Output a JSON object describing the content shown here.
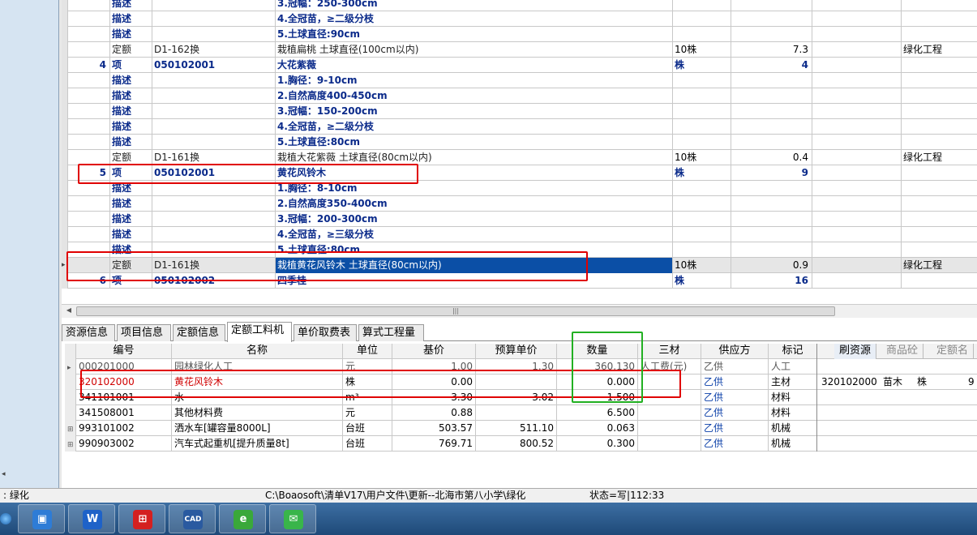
{
  "upper_grid": {
    "rows": [
      {
        "seq": "",
        "type": "描述",
        "code": "",
        "name": "3.冠幅：250-300cm",
        "unit": "",
        "qty": "",
        "cat": "",
        "kind": "desc"
      },
      {
        "seq": "",
        "type": "描述",
        "code": "",
        "name": "4.全冠苗，≥二级分枝",
        "unit": "",
        "qty": "",
        "cat": "",
        "kind": "desc"
      },
      {
        "seq": "",
        "type": "描述",
        "code": "",
        "name": "5.土球直径:90cm",
        "unit": "",
        "qty": "",
        "cat": "",
        "kind": "desc"
      },
      {
        "seq": "",
        "type": "定额",
        "code": "D1-162换",
        "name": "栽植扁桃 土球直径(100cm以内)",
        "unit": "10株",
        "qty": "7.3",
        "cat": "绿化工程",
        "kind": "quota"
      },
      {
        "seq": "4",
        "type": "项",
        "code": "050102001",
        "name": "大花紫薇",
        "unit": "株",
        "qty": "4",
        "cat": "",
        "kind": "bold"
      },
      {
        "seq": "",
        "type": "描述",
        "code": "",
        "name": "1.胸径：9-10cm",
        "unit": "",
        "qty": "",
        "cat": "",
        "kind": "desc"
      },
      {
        "seq": "",
        "type": "描述",
        "code": "",
        "name": "2.自然高度400-450cm",
        "unit": "",
        "qty": "",
        "cat": "",
        "kind": "desc"
      },
      {
        "seq": "",
        "type": "描述",
        "code": "",
        "name": "3.冠幅：150-200cm",
        "unit": "",
        "qty": "",
        "cat": "",
        "kind": "desc"
      },
      {
        "seq": "",
        "type": "描述",
        "code": "",
        "name": "4.全冠苗，≥二级分枝",
        "unit": "",
        "qty": "",
        "cat": "",
        "kind": "desc"
      },
      {
        "seq": "",
        "type": "描述",
        "code": "",
        "name": "5.土球直径:80cm",
        "unit": "",
        "qty": "",
        "cat": "",
        "kind": "desc"
      },
      {
        "seq": "",
        "type": "定额",
        "code": "D1-161换",
        "name": "栽植大花紫薇 土球直径(80cm以内)",
        "unit": "10株",
        "qty": "0.4",
        "cat": "绿化工程",
        "kind": "quota"
      },
      {
        "seq": "5",
        "type": "项",
        "code": "050102001",
        "name": "黄花风铃木",
        "unit": "株",
        "qty": "9",
        "cat": "",
        "kind": "bold"
      },
      {
        "seq": "",
        "type": "描述",
        "code": "",
        "name": "1.胸径：8-10cm",
        "unit": "",
        "qty": "",
        "cat": "",
        "kind": "desc"
      },
      {
        "seq": "",
        "type": "描述",
        "code": "",
        "name": "2.自然高度350-400cm",
        "unit": "",
        "qty": "",
        "cat": "",
        "kind": "desc"
      },
      {
        "seq": "",
        "type": "描述",
        "code": "",
        "name": "3.冠幅：200-300cm",
        "unit": "",
        "qty": "",
        "cat": "",
        "kind": "desc"
      },
      {
        "seq": "",
        "type": "描述",
        "code": "",
        "name": "4.全冠苗，≥三级分枝",
        "unit": "",
        "qty": "",
        "cat": "",
        "kind": "desc"
      },
      {
        "seq": "",
        "type": "描述",
        "code": "",
        "name": "5.土球直径:80cm",
        "unit": "",
        "qty": "",
        "cat": "",
        "kind": "desc"
      },
      {
        "seq": "",
        "type": "定额",
        "code": "D1-161换",
        "name": "栽植黄花风铃木 土球直径(80cm以内)",
        "unit": "10株",
        "qty": "0.9",
        "cat": "绿化工程",
        "kind": "quota sel"
      },
      {
        "seq": "6",
        "type": "项",
        "code": "050102002",
        "name": "四季桂",
        "unit": "株",
        "qty": "16",
        "cat": "",
        "kind": "bold"
      }
    ]
  },
  "tabs": [
    "资源信息",
    "项目信息",
    "定额信息",
    "定额工料机",
    "单价取费表",
    "算式工程量"
  ],
  "lower_grid": {
    "headers": [
      "编号",
      "名称",
      "单位",
      "基价",
      "预算单价",
      "数量",
      "三材",
      "供应方",
      "标记"
    ],
    "rows": [
      {
        "code": "000201000",
        "name": "园林绿化人工",
        "unit": "元",
        "base": "1.00",
        "price": "1.30",
        "qty": "360.130",
        "three": "人工费(元)",
        "supplier": "乙供",
        "mark": "人工",
        "tree": "",
        "style": "struck"
      },
      {
        "code": "320102000",
        "name": "黄花风铃木",
        "unit": "株",
        "base": "0.00",
        "price": "",
        "qty": "0.000",
        "three": "",
        "supplier": "乙供",
        "mark": "主材",
        "tree": "",
        "style": "red"
      },
      {
        "code": "341101001",
        "name": "水",
        "unit": "m³",
        "base": "3.30",
        "price": "3.02",
        "qty": "1.500",
        "three": "",
        "supplier": "乙供",
        "mark": "材料",
        "tree": "",
        "style": ""
      },
      {
        "code": "341508001",
        "name": "其他材料费",
        "unit": "元",
        "base": "0.88",
        "price": "",
        "qty": "6.500",
        "three": "",
        "supplier": "乙供",
        "mark": "材料",
        "tree": "",
        "style": ""
      },
      {
        "code": "993101002",
        "name": "洒水车[罐容量8000L]",
        "unit": "台班",
        "base": "503.57",
        "price": "511.10",
        "qty": "0.063",
        "three": "",
        "supplier": "乙供",
        "mark": "机械",
        "tree": "⊞",
        "style": ""
      },
      {
        "code": "990903002",
        "name": "汽车式起重机[提升质量8t]",
        "unit": "台班",
        "base": "769.71",
        "price": "800.52",
        "qty": "0.300",
        "three": "",
        "supplier": "乙供",
        "mark": "机械",
        "tree": "⊞",
        "style": ""
      }
    ]
  },
  "side_panel": {
    "tabs": [
      "刷资源",
      "商品砼",
      "定额名"
    ],
    "row": {
      "code": "320102000",
      "name": "苗木",
      "unit": "株",
      "value": "9"
    }
  },
  "statusbar": {
    "left": ": 绿化",
    "path": "C:\\Boaosoft\\清单V17\\用户文件\\更新--北海市第八小学\\绿化",
    "state": "状态=写|112:33"
  },
  "taskbar": {
    "apps": [
      {
        "icon": "box-app-icon",
        "glyph": "▣",
        "color": "#2e7cd6"
      },
      {
        "icon": "wps-icon",
        "glyph": "W",
        "color": "#1e62c8"
      },
      {
        "icon": "calculator-app-icon",
        "glyph": "⊞",
        "color": "#d42020"
      },
      {
        "icon": "cad-icon",
        "glyph": "CAD",
        "color": "#2a5aa0"
      },
      {
        "icon": "refresh-app-icon",
        "glyph": "e",
        "color": "#3aa83a"
      },
      {
        "icon": "wechat-icon",
        "glyph": "✉",
        "color": "#39b54a"
      }
    ]
  }
}
